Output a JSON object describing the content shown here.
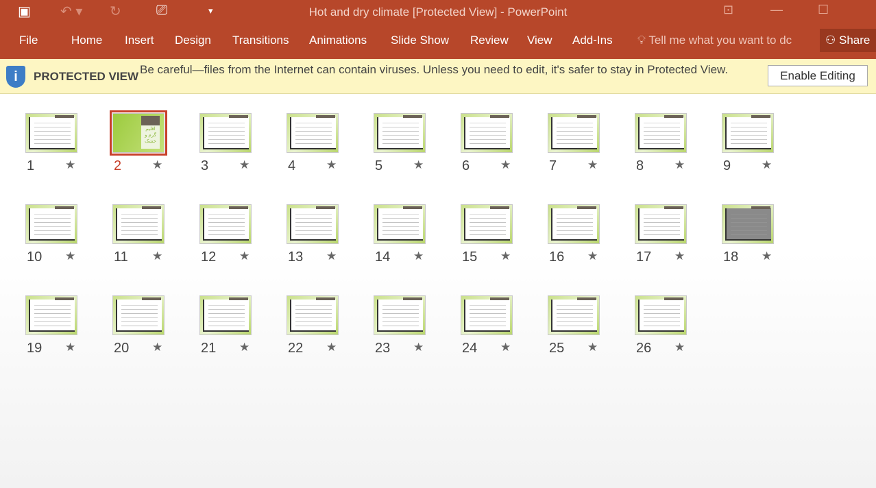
{
  "app": {
    "title": "Hot and dry climate [Protected View] - PowerPoint",
    "accent": "#b7472a"
  },
  "quick_access": [
    {
      "icon": "save-icon",
      "glyph": "💾"
    },
    {
      "icon": "undo-icon",
      "glyph": "↶"
    },
    {
      "icon": "redo-icon",
      "glyph": "↻"
    },
    {
      "icon": "slideshow-from-start-icon",
      "glyph": "⎚"
    },
    {
      "icon": "customize-dropdown-icon",
      "glyph": "▾"
    }
  ],
  "window_controls": [
    {
      "icon": "ribbon-display-icon",
      "glyph": "⊡"
    },
    {
      "icon": "minimize-icon",
      "glyph": "—"
    },
    {
      "icon": "maximize-icon",
      "glyph": "☐"
    }
  ],
  "ribbon": {
    "tabs": [
      "File",
      "Home",
      "Insert",
      "Design",
      "Transitions",
      "Animations",
      "Slide Show",
      "Review",
      "View",
      "Add-Ins"
    ],
    "tell_me": "Tell me what you want to dc",
    "share": "Share"
  },
  "protected_view": {
    "label": "PROTECTED VIEW",
    "message": "Be careful—files from the Internet can contain viruses. Unless you need to edit, it's safer to stay in Protected View.",
    "button": "Enable Editing"
  },
  "slides": {
    "selected": 2,
    "count": 26,
    "slide2_text": "اقلیم گرم و خشک",
    "numbers": [
      "1",
      "2",
      "3",
      "4",
      "5",
      "6",
      "7",
      "8",
      "9",
      "10",
      "11",
      "12",
      "13",
      "14",
      "15",
      "16",
      "17",
      "18",
      "19",
      "20",
      "21",
      "22",
      "23",
      "24",
      "25",
      "26"
    ]
  }
}
